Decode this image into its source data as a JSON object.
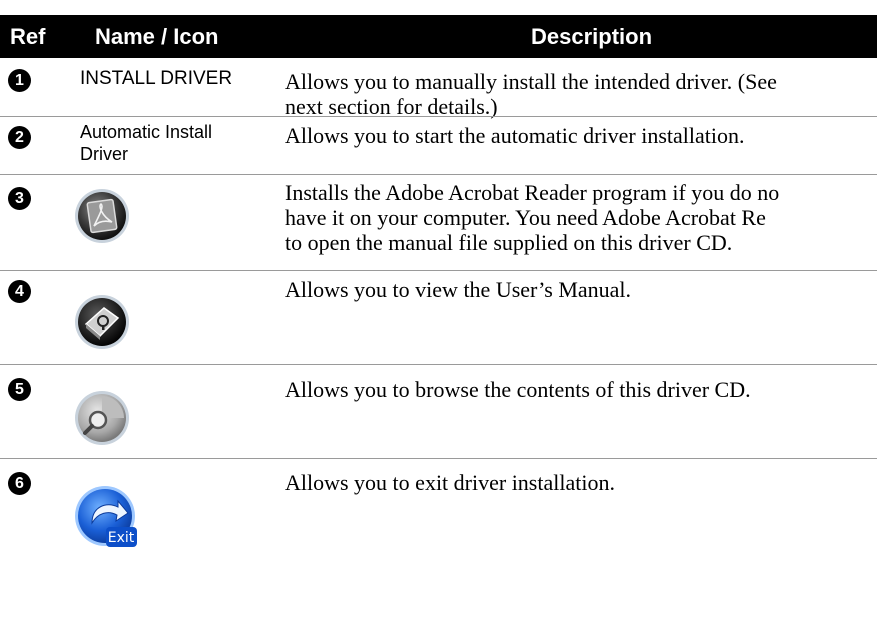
{
  "header": {
    "ref": "Ref",
    "name": "Name / Icon",
    "description": "Description"
  },
  "rows": [
    {
      "ref": "1",
      "name": "INSTALL DRIVER",
      "icon": null,
      "desc_lines": [
        "Allows you to manually install the intended driver. (See",
        "next section for details.)"
      ]
    },
    {
      "ref": "2",
      "name_lines": [
        "Automatic Install",
        "Driver"
      ],
      "icon": null,
      "desc_lines": [
        "Allows you to start the automatic driver installation."
      ]
    },
    {
      "ref": "3",
      "icon": "adobe-reader-icon",
      "desc_lines": [
        "Installs the Adobe Acrobat Reader program if you do no",
        "have it on your computer. You need Adobe Acrobat Re",
        "to open the manual file supplied on this driver CD."
      ]
    },
    {
      "ref": "4",
      "icon": "users-manual-icon",
      "desc_lines": [
        "Allows you to view the User’s Manual."
      ]
    },
    {
      "ref": "5",
      "icon": "browse-cd-icon",
      "desc_lines": [
        "Allows you to browse the contents of this driver CD."
      ]
    },
    {
      "ref": "6",
      "icon": "exit-icon",
      "icon_label": "Exit",
      "desc_lines": [
        "Allows you to exit driver installation."
      ]
    }
  ]
}
